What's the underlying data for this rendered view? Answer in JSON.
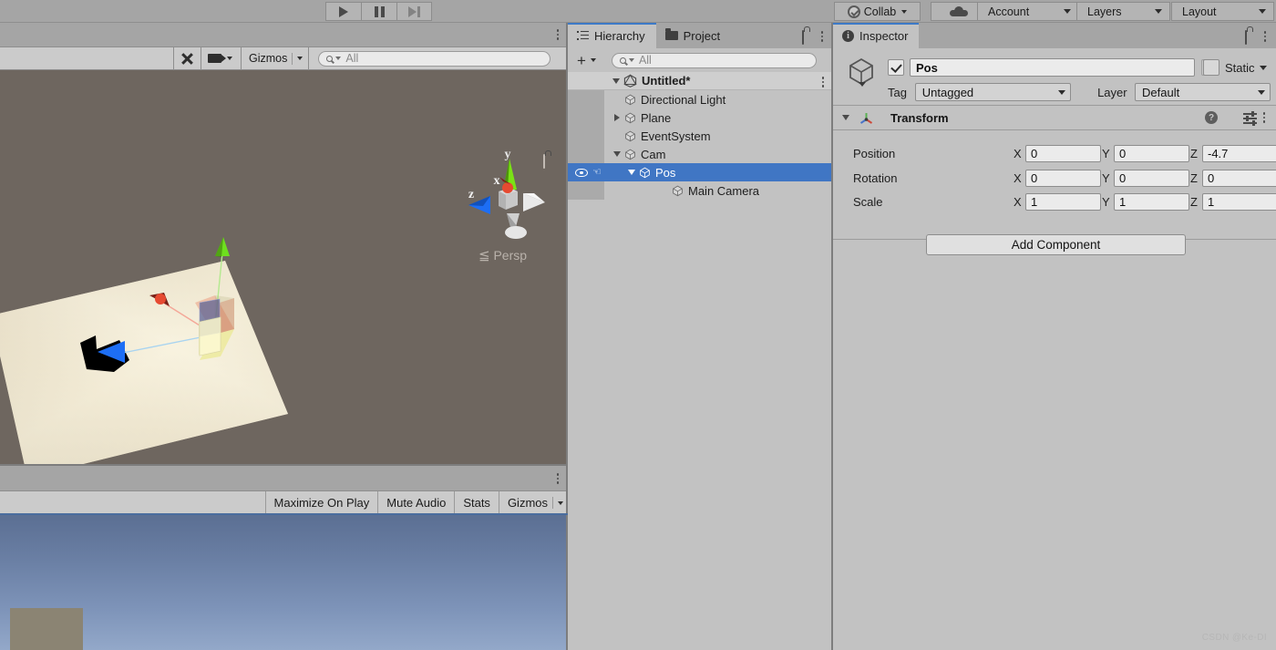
{
  "toolbar": {
    "play_label": "play-icon",
    "pause_label": "pause-icon",
    "step_label": "step-icon",
    "collab_label": "Collab",
    "cloud_label": "cloud-icon",
    "account_label": "Account",
    "layers_label": "Layers",
    "layout_label": "Layout"
  },
  "scene_panel": {
    "toolbar": {
      "tools_icon": "wrench-icon",
      "camera_icon": "camera-icon",
      "gizmos_label": "Gizmos",
      "search_value": "All"
    },
    "gizmo": {
      "x_label": "x",
      "y_label": "y",
      "z_label": "z",
      "projection_label": "Persp"
    },
    "kebab": "kebab-icon"
  },
  "game_panel": {
    "toolbar": {
      "maximize_label": "Maximize On Play",
      "mute_label": "Mute Audio",
      "stats_label": "Stats",
      "gizmos_label": "Gizmos"
    },
    "kebab": "kebab-icon"
  },
  "hierarchy": {
    "tabs": [
      {
        "label": "Hierarchy",
        "icon": "hierarchy-icon",
        "active": true
      },
      {
        "label": "Project",
        "icon": "folder-icon",
        "active": false
      }
    ],
    "lock_icon": "lock-icon",
    "kebab": "kebab-icon",
    "toolbar": {
      "add_label": "+",
      "search_value": "All"
    },
    "tree": [
      {
        "label": "Untitled*",
        "depth": 0,
        "icon": "unity-logo-icon",
        "expand": "down",
        "scene_root": true,
        "selected": false
      },
      {
        "label": "Directional Light",
        "depth": 2,
        "icon": "gameobject-icon",
        "expand": "none",
        "scene_root": false,
        "selected": false
      },
      {
        "label": "Plane",
        "depth": 2,
        "icon": "gameobject-icon",
        "expand": "right",
        "scene_root": false,
        "selected": false
      },
      {
        "label": "EventSystem",
        "depth": 2,
        "icon": "gameobject-icon",
        "expand": "none",
        "scene_root": false,
        "selected": false
      },
      {
        "label": "Cam",
        "depth": 2,
        "icon": "gameobject-icon",
        "expand": "down",
        "scene_root": false,
        "selected": false
      },
      {
        "label": "Pos",
        "depth": 3,
        "icon": "gameobject-icon",
        "expand": "down",
        "scene_root": false,
        "selected": true
      },
      {
        "label": "Main Camera",
        "depth": 4,
        "icon": "gameobject-icon",
        "expand": "none",
        "scene_root": false,
        "selected": false
      }
    ],
    "selected_row_icons": {
      "visibility": "eye-icon",
      "pickability": "hand-icon"
    }
  },
  "inspector": {
    "tab_label": "Inspector",
    "tab_icon": "info-icon",
    "lock_icon": "lock-icon",
    "kebab": "kebab-icon",
    "object": {
      "icon": "gameobject-icon",
      "enabled": true,
      "name": "Pos",
      "static_label": "Static",
      "static_checked": false,
      "tag_label": "Tag",
      "tag_value": "Untagged",
      "layer_label": "Layer",
      "layer_value": "Default"
    },
    "transform": {
      "title": "Transform",
      "icon": "transform-axes-icon",
      "help_icon": "help-icon",
      "preset_icon": "preset-icon",
      "kebab": "kebab-icon",
      "rows": [
        {
          "label": "Position",
          "x": "0",
          "y": "0",
          "z": "-4.7"
        },
        {
          "label": "Rotation",
          "x": "0",
          "y": "0",
          "z": "0"
        },
        {
          "label": "Scale",
          "x": "1",
          "y": "1",
          "z": "1"
        }
      ],
      "axis_labels": {
        "x": "X",
        "y": "Y",
        "z": "Z"
      }
    },
    "add_component_label": "Add Component"
  },
  "watermark": "CSDN @Ke-DI",
  "colors": {
    "selection_blue": "#4076c4",
    "tab_accent": "#3d7ac7",
    "panel_bg": "#c2c2c2",
    "chrome_bg": "#a5a5a5",
    "scene_bg": "#6e665f"
  }
}
